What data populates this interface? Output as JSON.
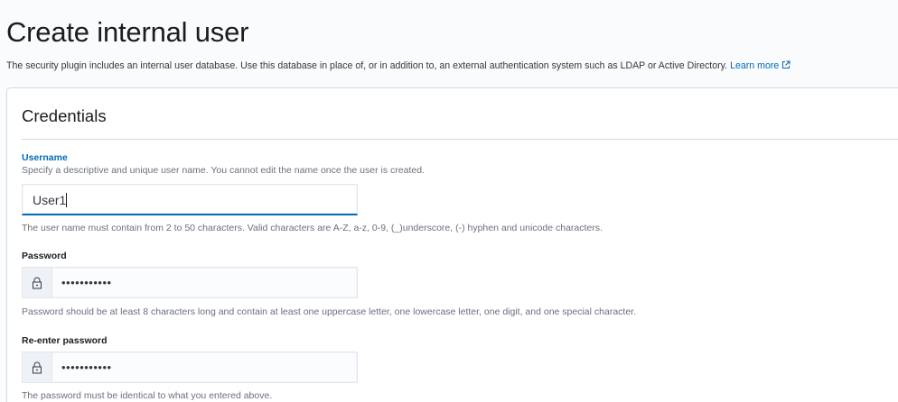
{
  "page": {
    "title": "Create internal user",
    "description": "The security plugin includes an internal user database. Use this database in place of, or in addition to, an external authentication system such as LDAP or Active Directory.",
    "learn_more": "Learn more",
    "external_icon": "external-link-icon"
  },
  "credentials": {
    "title": "Credentials",
    "username": {
      "label": "Username",
      "description": "Specify a descriptive and unique user name. You cannot edit the name once the user is created.",
      "value": "User1",
      "help": "The user name must contain from 2 to 50 characters. Valid characters are A-Z, a-z, 0-9, (_)underscore, (-) hyphen and unicode characters."
    },
    "password": {
      "label": "Password",
      "value": "•••••••••••",
      "icon": "lock-icon",
      "help": "Password should be at least 8 characters long and contain at least one uppercase letter, one lowercase letter, one digit, and one special character."
    },
    "reenter_password": {
      "label": "Re-enter password",
      "value": "•••••••••••",
      "icon": "lock-icon",
      "help": "The password must be identical to what you entered above."
    }
  },
  "colors": {
    "accent": "#006bb8",
    "text": "#343741",
    "muted": "#69707d",
    "border": "#d3dae6"
  }
}
